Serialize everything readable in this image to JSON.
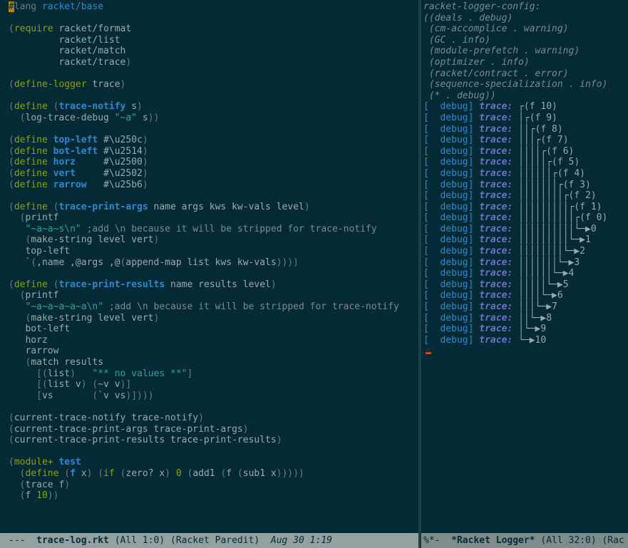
{
  "editor": {
    "source_lines": [
      [
        {
          "t": "#",
          "c": "hash"
        },
        {
          "t": "lang ",
          "c": "pr"
        },
        {
          "t": "racket/base",
          "c": "lang"
        }
      ],
      [],
      [
        {
          "t": "(",
          "c": "pr"
        },
        {
          "t": "require",
          "c": "kw"
        },
        {
          "t": " racket/format"
        }
      ],
      [
        {
          "t": "         racket/list"
        }
      ],
      [
        {
          "t": "         racket/match"
        }
      ],
      [
        {
          "t": "         racket/trace"
        },
        {
          "t": ")",
          "c": "pr"
        }
      ],
      [],
      [
        {
          "t": "(",
          "c": "pr"
        },
        {
          "t": "define-logger",
          "c": "kw"
        },
        {
          "t": " trace"
        },
        {
          "t": ")",
          "c": "pr"
        }
      ],
      [],
      [
        {
          "t": "(",
          "c": "pr"
        },
        {
          "t": "define",
          "c": "kw"
        },
        {
          "t": " "
        },
        {
          "t": "(",
          "c": "pr"
        },
        {
          "t": "trace-notify",
          "c": "fn"
        },
        {
          "t": " s"
        },
        {
          "t": ")",
          "c": "pr"
        }
      ],
      [
        {
          "t": "  "
        },
        {
          "t": "(",
          "c": "pr"
        },
        {
          "t": "log-trace-debug "
        },
        {
          "t": "\"~a\"",
          "c": "str"
        },
        {
          "t": " s"
        },
        {
          "t": "))",
          "c": "pr"
        }
      ],
      [],
      [
        {
          "t": "(",
          "c": "pr"
        },
        {
          "t": "define",
          "c": "kw"
        },
        {
          "t": " "
        },
        {
          "t": "top-left",
          "c": "fn"
        },
        {
          "t": " #\\u250c"
        },
        {
          "t": ")",
          "c": "pr"
        }
      ],
      [
        {
          "t": "(",
          "c": "pr"
        },
        {
          "t": "define",
          "c": "kw"
        },
        {
          "t": " "
        },
        {
          "t": "bot-left",
          "c": "fn"
        },
        {
          "t": " #\\u2514"
        },
        {
          "t": ")",
          "c": "pr"
        }
      ],
      [
        {
          "t": "(",
          "c": "pr"
        },
        {
          "t": "define",
          "c": "kw"
        },
        {
          "t": " "
        },
        {
          "t": "horz",
          "c": "fn"
        },
        {
          "t": "     #\\u2500"
        },
        {
          "t": ")",
          "c": "pr"
        }
      ],
      [
        {
          "t": "(",
          "c": "pr"
        },
        {
          "t": "define",
          "c": "kw"
        },
        {
          "t": " "
        },
        {
          "t": "vert",
          "c": "fn"
        },
        {
          "t": "     #\\u2502"
        },
        {
          "t": ")",
          "c": "pr"
        }
      ],
      [
        {
          "t": "(",
          "c": "pr"
        },
        {
          "t": "define",
          "c": "kw"
        },
        {
          "t": " "
        },
        {
          "t": "rarrow",
          "c": "fn"
        },
        {
          "t": "   #\\u25b6"
        },
        {
          "t": ")",
          "c": "pr"
        }
      ],
      [],
      [
        {
          "t": "(",
          "c": "pr"
        },
        {
          "t": "define",
          "c": "kw"
        },
        {
          "t": " "
        },
        {
          "t": "(",
          "c": "pr"
        },
        {
          "t": "trace-print-args",
          "c": "fn"
        },
        {
          "t": " name args kws kw-vals level"
        },
        {
          "t": ")",
          "c": "pr"
        }
      ],
      [
        {
          "t": "  "
        },
        {
          "t": "(",
          "c": "pr"
        },
        {
          "t": "printf"
        }
      ],
      [
        {
          "t": "   "
        },
        {
          "t": "\"~a~a~s\\n\"",
          "c": "str"
        },
        {
          "t": " "
        },
        {
          "t": ";add \\n because it will be stripped for trace-notify",
          "c": "cm"
        }
      ],
      [
        {
          "t": "   "
        },
        {
          "t": "(",
          "c": "pr"
        },
        {
          "t": "make-string level vert"
        },
        {
          "t": ")",
          "c": "pr"
        }
      ],
      [
        {
          "t": "   top-left"
        }
      ],
      [
        {
          "t": "   `"
        },
        {
          "t": "(",
          "c": "pr"
        },
        {
          "t": ",name ,@args ,@"
        },
        {
          "t": "(",
          "c": "pr"
        },
        {
          "t": "append-map list kws kw-vals"
        },
        {
          "t": "))))",
          "c": "pr"
        }
      ],
      [],
      [
        {
          "t": "(",
          "c": "pr"
        },
        {
          "t": "define",
          "c": "kw"
        },
        {
          "t": " "
        },
        {
          "t": "(",
          "c": "pr"
        },
        {
          "t": "trace-print-results",
          "c": "fn"
        },
        {
          "t": " name results level"
        },
        {
          "t": ")",
          "c": "pr"
        }
      ],
      [
        {
          "t": "  "
        },
        {
          "t": "(",
          "c": "pr"
        },
        {
          "t": "printf"
        }
      ],
      [
        {
          "t": "   "
        },
        {
          "t": "\"~a~a~a~a~a\\n\"",
          "c": "str"
        },
        {
          "t": " "
        },
        {
          "t": ";add \\n because it will be stripped for trace-notify",
          "c": "cm"
        }
      ],
      [
        {
          "t": "   "
        },
        {
          "t": "(",
          "c": "pr"
        },
        {
          "t": "make-string level vert"
        },
        {
          "t": ")",
          "c": "pr"
        }
      ],
      [
        {
          "t": "   bot-left"
        }
      ],
      [
        {
          "t": "   horz"
        }
      ],
      [
        {
          "t": "   rarrow"
        }
      ],
      [
        {
          "t": "   "
        },
        {
          "t": "(",
          "c": "pr"
        },
        {
          "t": "match results"
        }
      ],
      [
        {
          "t": "     "
        },
        {
          "t": "[(",
          "c": "pr"
        },
        {
          "t": "list"
        },
        {
          "t": ")",
          "c": "pr"
        },
        {
          "t": "   "
        },
        {
          "t": "\"** no values **\"",
          "c": "str"
        },
        {
          "t": "]",
          "c": "pr"
        }
      ],
      [
        {
          "t": "     "
        },
        {
          "t": "[(",
          "c": "pr"
        },
        {
          "t": "list v"
        },
        {
          "t": ")",
          "c": "pr"
        },
        {
          "t": " "
        },
        {
          "t": "(",
          "c": "pr"
        },
        {
          "t": "~v v"
        },
        {
          "t": ")]",
          "c": "pr"
        }
      ],
      [
        {
          "t": "     "
        },
        {
          "t": "[",
          "c": "pr"
        },
        {
          "t": "vs       "
        },
        {
          "t": "(",
          "c": "pr"
        },
        {
          "t": "`v vs"
        },
        {
          "t": ")])))",
          "c": "pr"
        }
      ],
      [],
      [
        {
          "t": "(",
          "c": "pr"
        },
        {
          "t": "current-trace-notify trace-notify"
        },
        {
          "t": ")",
          "c": "pr"
        }
      ],
      [
        {
          "t": "(",
          "c": "pr"
        },
        {
          "t": "current-trace-print-args trace-print-args"
        },
        {
          "t": ")",
          "c": "pr"
        }
      ],
      [
        {
          "t": "(",
          "c": "pr"
        },
        {
          "t": "current-trace-print-results trace-print-results"
        },
        {
          "t": ")",
          "c": "pr"
        }
      ],
      [],
      [
        {
          "t": "(",
          "c": "pr"
        },
        {
          "t": "module+",
          "c": "kw"
        },
        {
          "t": " "
        },
        {
          "t": "test",
          "c": "fn"
        }
      ],
      [
        {
          "t": "  "
        },
        {
          "t": "(",
          "c": "pr"
        },
        {
          "t": "define",
          "c": "kw"
        },
        {
          "t": " "
        },
        {
          "t": "(",
          "c": "pr"
        },
        {
          "t": "f",
          "c": "fn"
        },
        {
          "t": " x"
        },
        {
          "t": ")",
          "c": "pr"
        },
        {
          "t": " "
        },
        {
          "t": "(",
          "c": "pr"
        },
        {
          "t": "if",
          "c": "kw"
        },
        {
          "t": " "
        },
        {
          "t": "(",
          "c": "pr"
        },
        {
          "t": "zero? x"
        },
        {
          "t": ")",
          "c": "pr"
        },
        {
          "t": " "
        },
        {
          "t": "0",
          "c": "num"
        },
        {
          "t": " "
        },
        {
          "t": "(",
          "c": "pr"
        },
        {
          "t": "add1 "
        },
        {
          "t": "(",
          "c": "pr"
        },
        {
          "t": "f "
        },
        {
          "t": "(",
          "c": "pr"
        },
        {
          "t": "sub1 x"
        },
        {
          "t": ")))))",
          "c": "pr"
        }
      ],
      [
        {
          "t": "  "
        },
        {
          "t": "(",
          "c": "pr"
        },
        {
          "t": "trace f"
        },
        {
          "t": ")",
          "c": "pr"
        }
      ],
      [
        {
          "t": "  "
        },
        {
          "t": "(",
          "c": "pr"
        },
        {
          "t": "f "
        },
        {
          "t": "10",
          "c": "num"
        },
        {
          "t": "))",
          "c": "pr"
        }
      ]
    ],
    "modeline": {
      "status": "---",
      "buffer_name": "trace-log.rkt",
      "position": "(All 1:0)",
      "modes": "(Racket Paredit)",
      "date": "Aug 30 1:19"
    }
  },
  "logger": {
    "config_lines": [
      "racket-logger-config:",
      "((deals . debug)",
      " (cm-accomplice . warning)",
      " (GC . info)",
      " (module-prefetch . warning)",
      " (optimizer . info)",
      " (racket/contract . error)",
      " (sequence-specialization . info)",
      " (* . debug))"
    ],
    "level_label": "[  debug]",
    "topic_label": "trace:",
    "entries": [
      "┌(f 10)",
      "│┌(f 9)",
      "││┌(f 8)",
      "│││┌(f 7)",
      "││││┌(f 6)",
      "│││││┌(f 5)",
      "││││││┌(f 4)",
      "│││││││┌(f 3)",
      "││││││││┌(f 2)",
      "│││││││││┌(f 1)",
      "││││││││││┌(f 0)",
      "││││││││││└─▶0",
      "│││││││││└─▶1",
      "││││││││└─▶2",
      "│││││││└─▶3",
      "││││││└─▶4",
      "│││││└─▶5",
      "││││└─▶6",
      "│││└─▶7",
      "││└─▶8",
      "│└─▶9",
      "└─▶10"
    ],
    "modeline": {
      "status": "%*-",
      "buffer_name": "*Racket Logger*",
      "position": "(All 32:0)",
      "modes": "(Rac"
    }
  }
}
